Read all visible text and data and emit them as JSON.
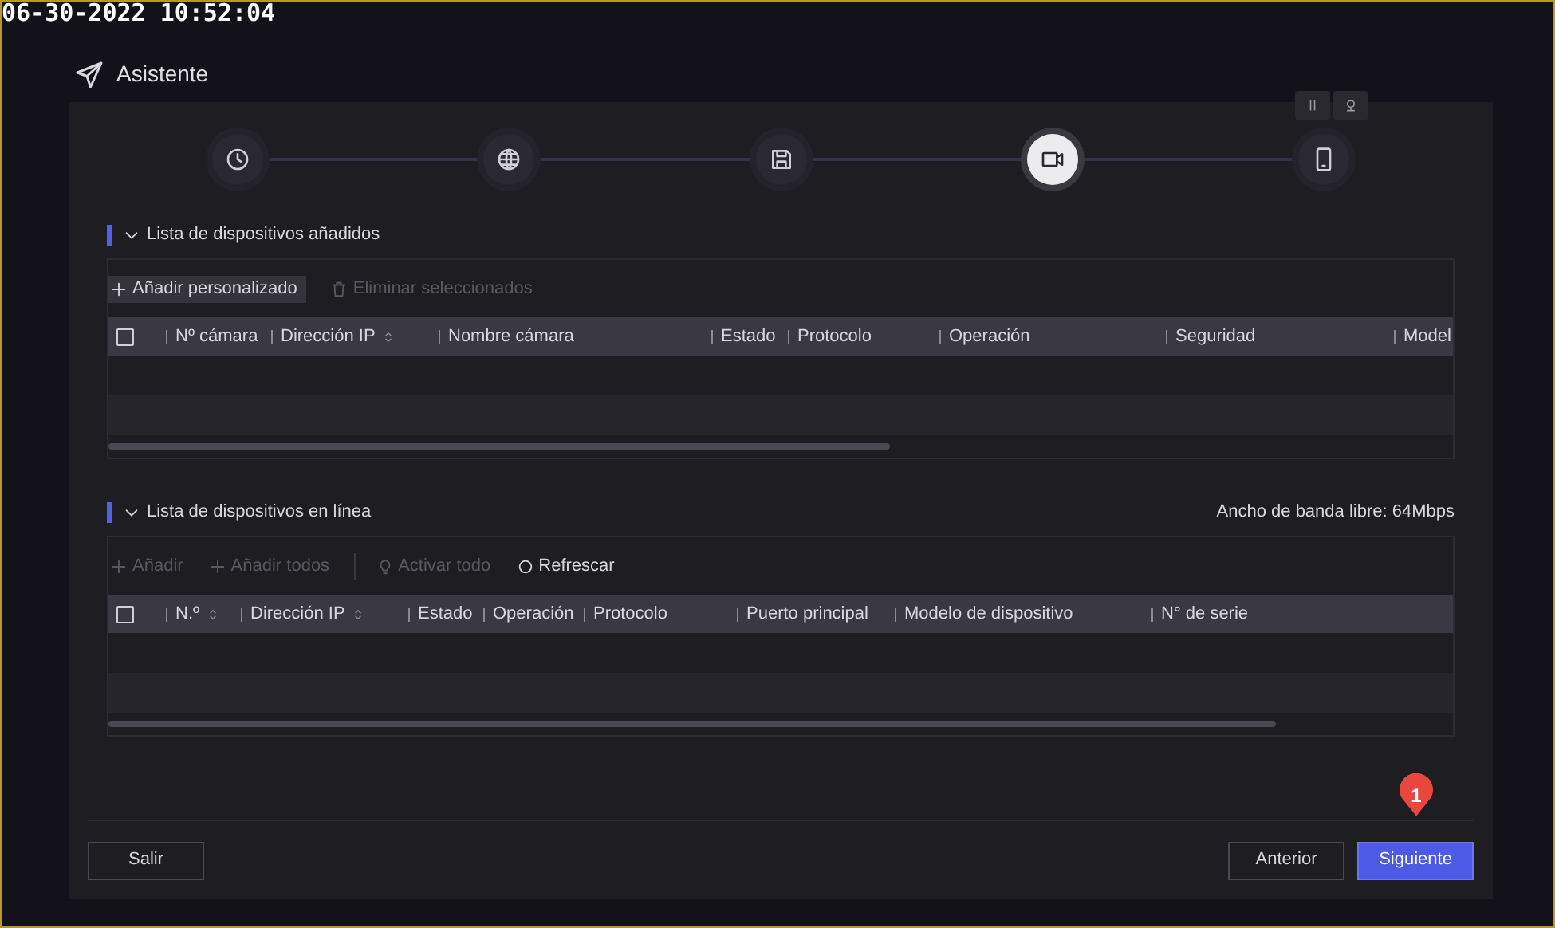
{
  "timestamp": "06-30-2022 10:52:04",
  "window": {
    "title": "Asistente"
  },
  "top_controls": [
    {
      "kind": "pause"
    },
    {
      "kind": "camera"
    }
  ],
  "steps": [
    {
      "kind": "clock",
      "selected": false
    },
    {
      "kind": "globe",
      "selected": false
    },
    {
      "kind": "disk",
      "selected": false
    },
    {
      "kind": "camera",
      "selected": true
    },
    {
      "kind": "phone",
      "selected": false
    }
  ],
  "sections": [
    {
      "title": "Lista de dispositivos añadidos",
      "expanded": true,
      "toolbar": [
        {
          "kind": "plus",
          "label": "Añadir personalizado",
          "disabled": false,
          "hovered": true
        },
        {
          "kind": "trash",
          "label": "Eliminar seleccionados",
          "disabled": true,
          "hovered": false
        }
      ],
      "table": {
        "select_all": {
          "checked": false
        },
        "columns": [
          {
            "label": "Nº cámara",
            "sortable": false
          },
          {
            "label": "Dirección IP",
            "sortable": true
          },
          {
            "label": "Nombre cámara",
            "sortable": false
          },
          {
            "label": "Estado",
            "sortable": false
          },
          {
            "label": "Protocolo",
            "sortable": false
          },
          {
            "label": "Operación",
            "sortable": false
          },
          {
            "label": "Seguridad",
            "sortable": false
          },
          {
            "label": "Model",
            "sortable": false
          }
        ]
      }
    },
    {
      "title": "Lista de dispositivos en línea",
      "expanded": true,
      "info": "Ancho de banda libre: 64Mbps",
      "toolbar": [
        {
          "kind": "plus",
          "label": "Añadir",
          "disabled": true,
          "hovered": false
        },
        {
          "kind": "plus",
          "label": "Añadir todos",
          "disabled": true,
          "hovered": false
        },
        {
          "kind": "bulb",
          "label": "Activar todo",
          "disabled": true,
          "hovered": false
        },
        {
          "kind": "refresh",
          "label": "Refrescar",
          "disabled": false,
          "hovered": false
        }
      ],
      "table": {
        "select_all": {
          "checked": false
        },
        "columns": [
          {
            "label": "N.º",
            "sortable": true
          },
          {
            "label": "Dirección IP",
            "sortable": true
          },
          {
            "label": "Estado",
            "sortable": false
          },
          {
            "label": "Operación",
            "sortable": false
          },
          {
            "label": "Protocolo",
            "sortable": false
          },
          {
            "label": "Puerto principal",
            "sortable": false
          },
          {
            "label": "Modelo de dispositivo",
            "sortable": false
          },
          {
            "label": "N° de serie",
            "sortable": false
          }
        ]
      }
    }
  ],
  "footer": {
    "left": [
      {
        "label": "Salir",
        "primary": false
      }
    ],
    "right": [
      {
        "label": "Anterior",
        "primary": false
      },
      {
        "label": "Siguiente",
        "primary": true
      }
    ]
  },
  "marker": {
    "label": "1"
  }
}
